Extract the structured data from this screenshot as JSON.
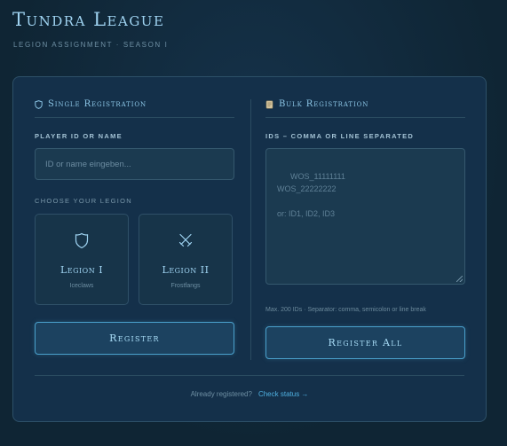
{
  "header": {
    "title": "Tundra League",
    "subtitle": "LEGION ASSIGNMENT · SEASON I"
  },
  "single": {
    "title": "Single Registration",
    "player_label": "PLAYER ID OR NAME",
    "player_placeholder": "ID or name eingeben...",
    "choose_label": "CHOOSE YOUR LEGION",
    "legions": [
      {
        "name": "Legion I",
        "sub": "Iceclaws",
        "icon": "shield-icon"
      },
      {
        "name": "Legion II",
        "sub": "Frostfangs",
        "icon": "crossed-swords-icon"
      }
    ],
    "register_label": "Register"
  },
  "bulk": {
    "title": "Bulk Registration",
    "ids_label": "IDS – COMMA OR LINE SEPARATED",
    "placeholder": "WOS_11111111\nWOS_22222222\n\nor: ID1, ID2, ID3",
    "hint": "Max. 200 IDs · Separator: comma, semicolon or line break",
    "register_all_label": "Register All"
  },
  "footer": {
    "question": "Already registered?",
    "link": "Check status →"
  },
  "colors": {
    "accent": "#4aa0cc",
    "title": "#9fd3f1",
    "background": "#0f2534",
    "card": "#14304a"
  }
}
